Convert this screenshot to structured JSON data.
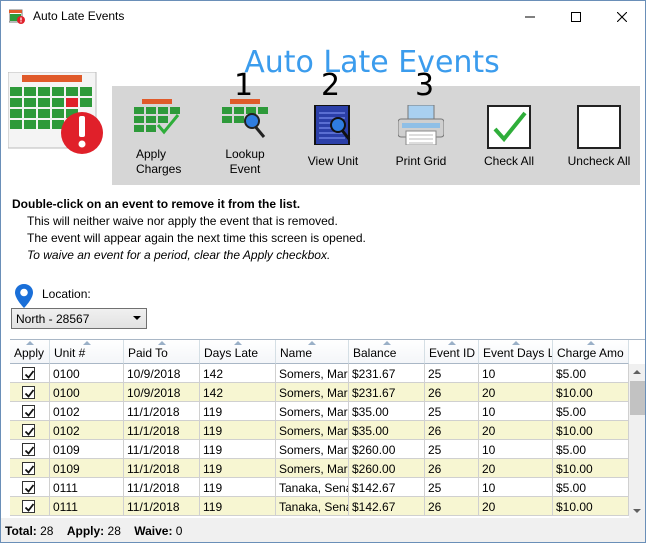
{
  "window": {
    "title": "Auto Late Events"
  },
  "app_title": "Auto Late Events",
  "toolbar": {
    "tools": [
      {
        "label_line1": "Apply",
        "label_line2": "Charges",
        "icon": "apply-charges-icon"
      },
      {
        "label_line1": "Lookup",
        "label_line2": "Event",
        "icon": "lookup-event-icon",
        "step": "1"
      },
      {
        "label_line1": "View Unit",
        "label_line2": "",
        "icon": "view-unit-icon",
        "step": "2"
      },
      {
        "label_line1": "Print Grid",
        "label_line2": "",
        "icon": "print-grid-icon",
        "step": "3"
      },
      {
        "label_line1": "Check All",
        "label_line2": "",
        "icon": "check-all-icon"
      },
      {
        "label_line1": "Uncheck All",
        "label_line2": "",
        "icon": "uncheck-all-icon"
      }
    ]
  },
  "instructions": {
    "bold": "Double-click on an event to remove it from the list.",
    "line1": "This will neither waive nor apply the event that is removed.",
    "line2": "The event will appear again the next time this screen is opened.",
    "italic": "To waive an event for a period, clear the Apply checkbox."
  },
  "location": {
    "label": "Location:",
    "selected": "North - 28567"
  },
  "grid": {
    "columns": [
      "Apply",
      "Unit #",
      "Paid To",
      "Days Late",
      "Name",
      "Balance",
      "Event ID",
      "Event Days L",
      "Charge Amo"
    ],
    "rows": [
      {
        "apply": true,
        "unit": "0100",
        "paid_to": "10/9/2018",
        "days_late": "142",
        "name": "Somers, Marl",
        "balance": "$231.67",
        "event_id": "25",
        "event_days": "10",
        "charge": "$5.00"
      },
      {
        "apply": true,
        "unit": "0100",
        "paid_to": "10/9/2018",
        "days_late": "142",
        "name": "Somers, Marl",
        "balance": "$231.67",
        "event_id": "26",
        "event_days": "20",
        "charge": "$10.00"
      },
      {
        "apply": true,
        "unit": "0102",
        "paid_to": "11/1/2018",
        "days_late": "119",
        "name": "Somers, Marl",
        "balance": "$35.00",
        "event_id": "25",
        "event_days": "10",
        "charge": "$5.00"
      },
      {
        "apply": true,
        "unit": "0102",
        "paid_to": "11/1/2018",
        "days_late": "119",
        "name": "Somers, Marl",
        "balance": "$35.00",
        "event_id": "26",
        "event_days": "20",
        "charge": "$10.00"
      },
      {
        "apply": true,
        "unit": "0109",
        "paid_to": "11/1/2018",
        "days_late": "119",
        "name": "Somers, Marl",
        "balance": "$260.00",
        "event_id": "25",
        "event_days": "10",
        "charge": "$5.00"
      },
      {
        "apply": true,
        "unit": "0109",
        "paid_to": "11/1/2018",
        "days_late": "119",
        "name": "Somers, Marl",
        "balance": "$260.00",
        "event_id": "26",
        "event_days": "20",
        "charge": "$10.00"
      },
      {
        "apply": true,
        "unit": "0111",
        "paid_to": "11/1/2018",
        "days_late": "119",
        "name": "Tanaka, Sena",
        "balance": "$142.67",
        "event_id": "25",
        "event_days": "10",
        "charge": "$5.00"
      },
      {
        "apply": true,
        "unit": "0111",
        "paid_to": "11/1/2018",
        "days_late": "119",
        "name": "Tanaka, Sena",
        "balance": "$142.67",
        "event_id": "26",
        "event_days": "20",
        "charge": "$10.00"
      }
    ]
  },
  "footer": {
    "total_label": "Total:",
    "total_value": "28",
    "apply_label": "Apply:",
    "apply_value": "28",
    "waive_label": "Waive:",
    "waive_value": "0"
  },
  "colors": {
    "title_blue": "#3b9ced",
    "alt_row": "#f7f6d2",
    "toolbar_bg": "#d6d6d6",
    "check_green": "#2fae3a",
    "alert_red": "#e0202a"
  }
}
